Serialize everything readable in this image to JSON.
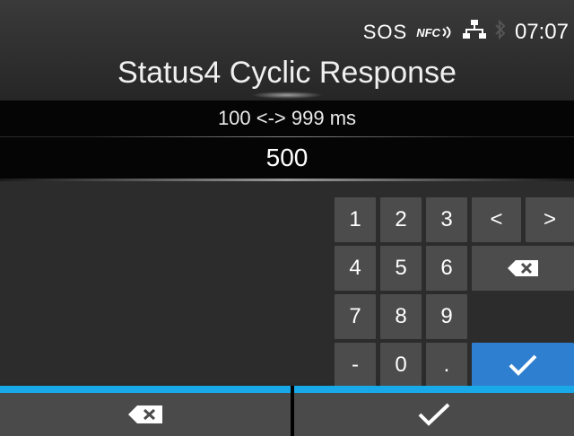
{
  "status": {
    "sos": "SOS",
    "nfc": "NFC",
    "time": "07:07",
    "icons": [
      "sos-indicator",
      "nfc-icon",
      "network-icon",
      "bluetooth-icon"
    ]
  },
  "title": "Status4 Cyclic Response",
  "range": "100 <-> 999 ms",
  "value": "500",
  "keypad": {
    "keys": [
      {
        "label": "1"
      },
      {
        "label": "2"
      },
      {
        "label": "3"
      },
      {
        "label": "<"
      },
      {
        "label": ">"
      },
      {
        "label": "4"
      },
      {
        "label": "5"
      },
      {
        "label": "6"
      },
      {
        "label": "7"
      },
      {
        "label": "8"
      },
      {
        "label": "9"
      },
      {
        "label": "-"
      },
      {
        "label": "0"
      },
      {
        "label": "."
      }
    ],
    "backspace_icon": "backspace-icon",
    "enter_icon": "check-icon"
  },
  "softkeys": {
    "left_icon": "backspace-icon",
    "right_icon": "check-icon"
  },
  "colors": {
    "accent": "#19a8e8",
    "enter": "#2f7fd0",
    "key": "#4c4c4c"
  }
}
